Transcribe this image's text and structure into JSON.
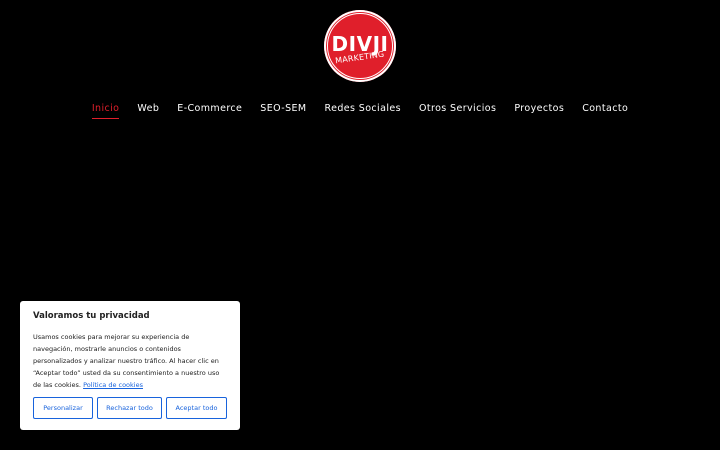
{
  "logo": {
    "main": "DIVJI",
    "sub": "MARKETING"
  },
  "nav": {
    "items": [
      {
        "label": "Inicio",
        "active": true
      },
      {
        "label": "Web",
        "active": false
      },
      {
        "label": "E-Commerce",
        "active": false
      },
      {
        "label": "SEO-SEM",
        "active": false
      },
      {
        "label": "Redes Sociales",
        "active": false
      },
      {
        "label": "Otros Servicios",
        "active": false
      },
      {
        "label": "Proyectos",
        "active": false
      },
      {
        "label": "Contacto",
        "active": false
      }
    ]
  },
  "cookie_banner": {
    "title": "Valoramos tu privacidad",
    "text": "Usamos cookies para mejorar su experiencia de navegación, mostrarle anuncios o contenidos personalizados y analizar nuestro tráfico. Al hacer clic en “Aceptar todo” usted da su consentimiento a nuestro uso de las cookies.",
    "policy_link": "Política de cookies",
    "buttons": {
      "customize": "Personalizar",
      "reject": "Rechazar todo",
      "accept": "Aceptar todo"
    }
  },
  "colors": {
    "background": "#000000",
    "brand_red": "#e01f2b",
    "button_blue": "#1863dc",
    "text_dark": "#212121"
  }
}
